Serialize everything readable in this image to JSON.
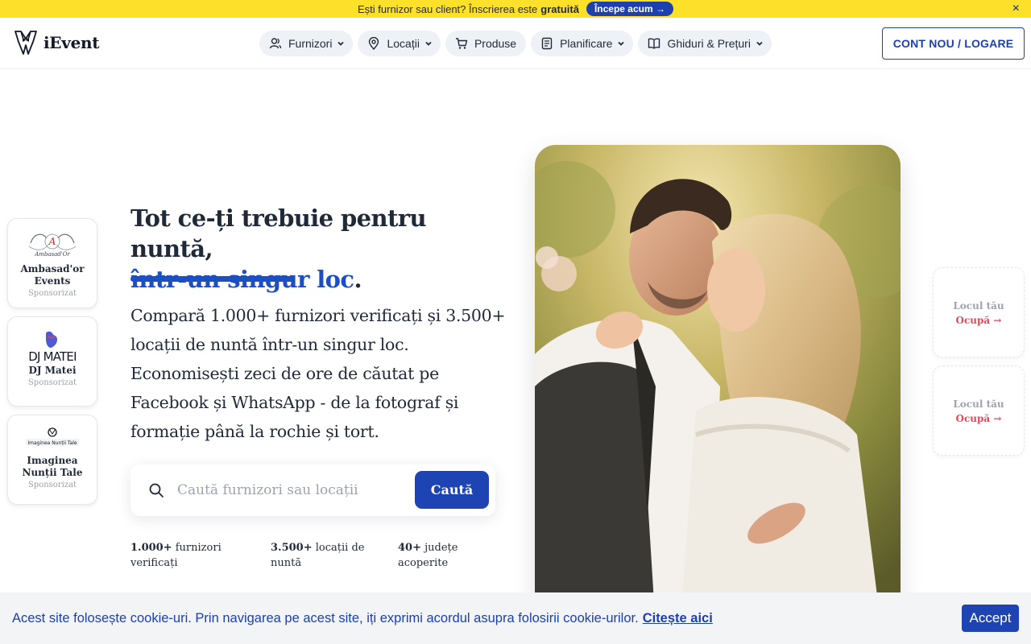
{
  "topbar": {
    "text": "Ești furnizor sau client? Înscrierea este",
    "bold": "gratuită",
    "cta": "Începe acum →",
    "close": "×"
  },
  "header": {
    "logo": "iEvent",
    "nav": [
      {
        "label": "Furnizori",
        "icon": "user-icon",
        "dropdown": true
      },
      {
        "label": "Locații",
        "icon": "location-pin-icon",
        "dropdown": true
      },
      {
        "label": "Produse",
        "icon": "cart-icon",
        "dropdown": false
      },
      {
        "label": "Planificare",
        "icon": "checklist-icon",
        "dropdown": true
      },
      {
        "label": "Ghiduri & Prețuri",
        "icon": "book-icon",
        "dropdown": true
      }
    ],
    "login": "CONT NOU / LOGARE"
  },
  "hero": {
    "headline_1": "Tot ce-ți trebuie pentru nuntă,",
    "headline_2": "într-un singur loc",
    "headline_end": ".",
    "lead": "Compară 1.000+ furnizori verificați și 3.500+ locații de nuntă într-un singur loc. Economisești zeci de ore de căutat pe Facebook și WhatsApp - de la fotograf și formație până la rochie și tort.",
    "search": {
      "placeholder": "Caută furnizori sau locații",
      "button": "Caută"
    },
    "stats": [
      {
        "value": "1.000+",
        "label": "furnizori verificați"
      },
      {
        "value": "3.500+",
        "label": "locații de nuntă"
      },
      {
        "value": "40+",
        "label": "județe acoperite"
      }
    ]
  },
  "sponsored": [
    {
      "name": "Ambasad'or Events",
      "tag": "Sponsorizat",
      "logo_text": "Ambasad'Or"
    },
    {
      "name": "DJ Matei",
      "tag": "Sponsorizat",
      "logo_text": "DJ MATEI"
    },
    {
      "name": "Imaginea Nunții Tale",
      "tag": "Sponsorizat",
      "logo_text": "Imaginea Nunții Tale"
    }
  ],
  "slots": [
    {
      "line1": "Locul tău",
      "line2": "Ocupă →"
    },
    {
      "line1": "Locul tău",
      "line2": "Ocupă →"
    }
  ],
  "cookie": {
    "text": "Acest site folosește cookie-uri. Prin navigarea pe acest site, iți exprimi acordul asupra folosirii cookie-urilor.",
    "link": "Citește aici",
    "accept": "Accept"
  }
}
